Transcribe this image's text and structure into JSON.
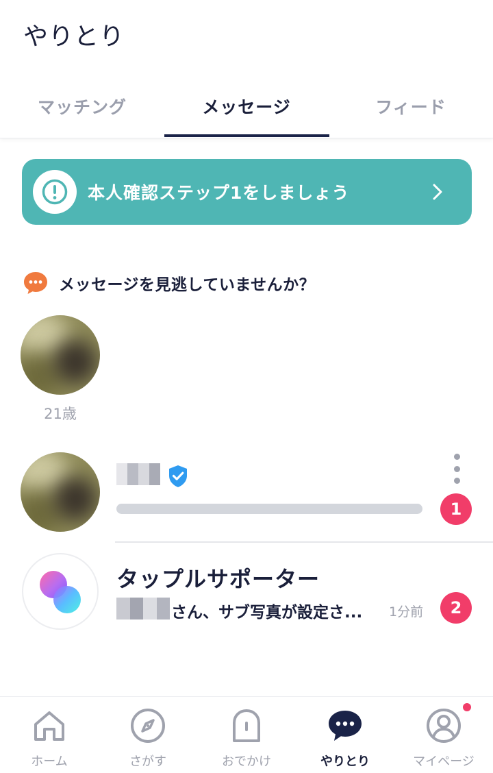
{
  "header": {
    "title": "やりとり"
  },
  "tabs": [
    {
      "label": "マッチング",
      "active": false
    },
    {
      "label": "メッセージ",
      "active": true
    },
    {
      "label": "フィード",
      "active": false
    }
  ],
  "banner": {
    "text": "本人確認ステップ1をしましょう",
    "icon": "exclamation-circle-icon",
    "color": "#4fb6b4"
  },
  "missed": {
    "heading": "メッセージを見逃していませんか？",
    "icon": "chat-bubble-icon",
    "suggestion": {
      "age": "21歳"
    }
  },
  "messages": [
    {
      "name": "",
      "verified": true,
      "preview": "",
      "unread": "1"
    },
    {
      "name": "タップルサポーター",
      "preview": "さん、サブ写真が設定さ...",
      "time": "1分前",
      "unread": "2"
    }
  ],
  "tabbar": [
    {
      "label": "ホーム",
      "icon": "home-icon",
      "active": false
    },
    {
      "label": "さがす",
      "icon": "compass-icon",
      "active": false
    },
    {
      "label": "おでかけ",
      "icon": "door-icon",
      "active": false
    },
    {
      "label": "やりとり",
      "icon": "chat-icon",
      "active": true
    },
    {
      "label": "マイページ",
      "icon": "profile-icon",
      "active": false,
      "notification": true
    }
  ],
  "colors": {
    "accent": "#4fb6b4",
    "badge": "#f13d69",
    "navy": "#1a2348",
    "muted": "#9fa2ad"
  }
}
